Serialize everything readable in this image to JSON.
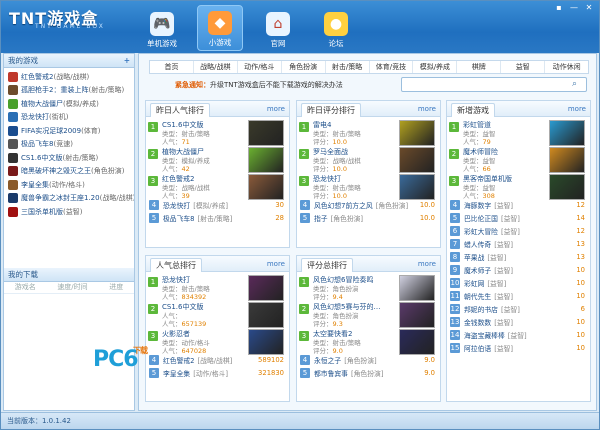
{
  "app": {
    "logo": "TNT游戏盒",
    "logo_sub": "TNT GAME BOX",
    "version": "当前版本：1.0.1.42"
  },
  "window": {
    "btns": [
      "▪",
      "—",
      "✕"
    ]
  },
  "nav": [
    {
      "label": "单机游戏",
      "icon": "🎮"
    },
    {
      "label": "小游戏",
      "icon": "◆"
    },
    {
      "label": "官网",
      "icon": "⌂"
    },
    {
      "label": "论坛",
      "icon": "●"
    }
  ],
  "sidebar": {
    "my_games_title": "我的游戏",
    "add": "+",
    "games": [
      {
        "name": "红色警戒2",
        "type": "(战略/战棋)",
        "color": "#c0392b"
      },
      {
        "name": "孤胆枪手2：重装上阵",
        "type": "(射击/策略)",
        "color": "#6d4c2c"
      },
      {
        "name": "植物大战僵尸",
        "type": "(模拟/养成)",
        "color": "#4aa02c"
      },
      {
        "name": "恐龙快打",
        "type": "(街机)",
        "color": "#2a6fb5"
      },
      {
        "name": "FIFA实况足球2009",
        "type": "(体育)",
        "color": "#1a4d8f"
      },
      {
        "name": "极品飞车8",
        "type": "(竞速)",
        "color": "#555"
      },
      {
        "name": "CS1.6中文版",
        "type": "(射击/策略)",
        "color": "#333"
      },
      {
        "name": "暗黑破坏神之毁灭之王",
        "type": "(角色扮演)",
        "color": "#7a1a1a"
      },
      {
        "name": "李皇全集",
        "type": "(动作/格斗)",
        "color": "#8a5a2a"
      },
      {
        "name": "魔兽争霸之冰封王座1.20",
        "type": "(战略/战棋)",
        "color": "#1a3a6a"
      },
      {
        "name": "三国杀单机版",
        "type": "(益智)",
        "color": "#a01010"
      }
    ],
    "my_dl_title": "我的下载",
    "dl_cols": [
      "游戏名",
      "速度/时间",
      "进度"
    ]
  },
  "categories": [
    "首页",
    "战略/战棋",
    "动作/格斗",
    "角色扮演",
    "射击/策略",
    "体育/竞技",
    "模拟/养成",
    "棋牌",
    "益智",
    "动作休闲"
  ],
  "notice": {
    "label": "紧急通知：",
    "text": "升级TNT游戏盒后不能下载游戏的解决办法"
  },
  "panels": {
    "yesterday_hot": {
      "title": "昨日人气排行",
      "more": "more",
      "top": [
        {
          "rank": "1",
          "name": "CS1.6中文版",
          "l1": "类型：射击/策略",
          "l2": "人气：",
          "v": "71",
          "c": "#3a3a2a"
        },
        {
          "rank": "2",
          "name": "植物大战僵尸",
          "l1": "类型：模拟/养成",
          "l2": "人气：",
          "v": "42",
          "c": "#6ab030"
        },
        {
          "rank": "3",
          "name": "红色警戒2",
          "l1": "类型：战略/战棋",
          "l2": "人气：",
          "v": "39",
          "c": "#8a5a3a"
        }
      ],
      "rest": [
        {
          "rank": "4",
          "name": "恐龙快打",
          "type": "[模拟/养成]",
          "num": "30"
        },
        {
          "rank": "5",
          "name": "极品飞车8",
          "type": "[射击/策略]",
          "num": "28"
        }
      ]
    },
    "yesterday_score": {
      "title": "昨日评分排行",
      "more": "more",
      "top": [
        {
          "rank": "1",
          "name": "雷电4",
          "l1": "类型：射击/策略",
          "l2": "评分：",
          "v": "10.0",
          "c": "#b0a020"
        },
        {
          "rank": "2",
          "name": "罗马全面战",
          "l1": "类型：战略/战棋",
          "l2": "评分：",
          "v": "10.0",
          "c": "#6a4a2a"
        },
        {
          "rank": "3",
          "name": "恐龙快打",
          "l1": "类型：射击/策略",
          "l2": "评分：",
          "v": "10.0",
          "c": "#3a6a9a"
        }
      ],
      "rest": [
        {
          "rank": "4",
          "name": "风色幻想7前方之风",
          "type": "[角色扮演]",
          "num": "10.0"
        },
        {
          "rank": "5",
          "name": "指子",
          "type": "[角色扮演]",
          "num": "10.0"
        }
      ]
    },
    "new_games": {
      "title": "新增游戏",
      "more": "more",
      "top": [
        {
          "rank": "1",
          "name": "彩虹管道",
          "l1": "类型：益智",
          "l2": "人气：",
          "v": "79",
          "c": "#2a9ad0"
        },
        {
          "rank": "2",
          "name": "魔术师冒险",
          "l1": "类型：益智",
          "l2": "人气：",
          "v": "66",
          "c": "#d08a20"
        },
        {
          "rank": "3",
          "name": "黑客帝国单机版",
          "l1": "类型：益智",
          "l2": "人气：",
          "v": "308",
          "c": "#2a4a2a"
        }
      ],
      "rest": [
        {
          "rank": "4",
          "name": "海豚数字",
          "type": "[益智]",
          "num": "12"
        },
        {
          "rank": "5",
          "name": "巴比伦正国",
          "type": "[益智]",
          "num": "14"
        },
        {
          "rank": "6",
          "name": "彩虹大冒险",
          "type": "[益智]",
          "num": "12"
        },
        {
          "rank": "7",
          "name": "蜡人传奇",
          "type": "[益智]",
          "num": "13"
        },
        {
          "rank": "8",
          "name": "苹果战",
          "type": "[益智]",
          "num": "13"
        },
        {
          "rank": "9",
          "name": "魔术师子",
          "type": "[益智]",
          "num": "10"
        },
        {
          "rank": "10",
          "name": "彩虹网",
          "type": "[益智]",
          "num": "10"
        },
        {
          "rank": "11",
          "name": "朝代先生",
          "type": "[益智]",
          "num": "10"
        },
        {
          "rank": "12",
          "name": "邦妮的书店",
          "type": "[益智]",
          "num": "6"
        },
        {
          "rank": "13",
          "name": "金钱数数",
          "type": "[益智]",
          "num": "10"
        },
        {
          "rank": "14",
          "name": "海盗宝藏棒棒",
          "type": "[益智]",
          "num": "10"
        },
        {
          "rank": "15",
          "name": "阿拉伯语",
          "type": "[益智]",
          "num": "10"
        }
      ]
    },
    "total_hot": {
      "title": "人气总排行",
      "more": "more",
      "top": [
        {
          "rank": "1",
          "name": "恐龙快打",
          "l1": "类型：射击/策略",
          "l2": "人气：",
          "v": "834392",
          "c": "#5a2a5a"
        },
        {
          "rank": "2",
          "name": "CS1.6中文版",
          "l1": "人气：",
          "l2": "人气：",
          "v": "657139",
          "c": "#3a3a3a"
        },
        {
          "rank": "3",
          "name": "火影忍者",
          "l1": "类型：动作/格斗",
          "l2": "人气：",
          "v": "647028",
          "c": "#2a4a8a"
        }
      ],
      "rest": [
        {
          "rank": "4",
          "name": "红色警戒2",
          "type": "[战略/战棋]",
          "num": "589102"
        },
        {
          "rank": "5",
          "name": "李皇全集",
          "type": "[动作/格斗]",
          "num": "321830"
        }
      ]
    },
    "total_score": {
      "title": "评分总排行",
      "more": "more",
      "top": [
        {
          "rank": "1",
          "name": "风色幻想6冒险奏鸣",
          "l1": "类型：角色扮演",
          "l2": "评分：",
          "v": "9.4",
          "c": "#d0d0e0"
        },
        {
          "rank": "2",
          "name": "风色幻想5赛与芬的…",
          "l1": "类型：角色扮演",
          "l2": "评分：",
          "v": "9.3",
          "c": "#5a3a6a"
        },
        {
          "rank": "3",
          "name": "太空要快看2",
          "l1": "类型：射击/策略",
          "l2": "评分：",
          "v": "9.0",
          "c": "#2a2a5a"
        }
      ],
      "rest": [
        {
          "rank": "4",
          "name": "永恒之子",
          "type": "[角色扮演]",
          "num": "9.0"
        },
        {
          "rank": "5",
          "name": "都市鲁宾事",
          "type": "[角色扮演]",
          "num": "9.0"
        }
      ]
    }
  },
  "watermark": {
    "text": "PC6",
    "sub": "下载"
  }
}
